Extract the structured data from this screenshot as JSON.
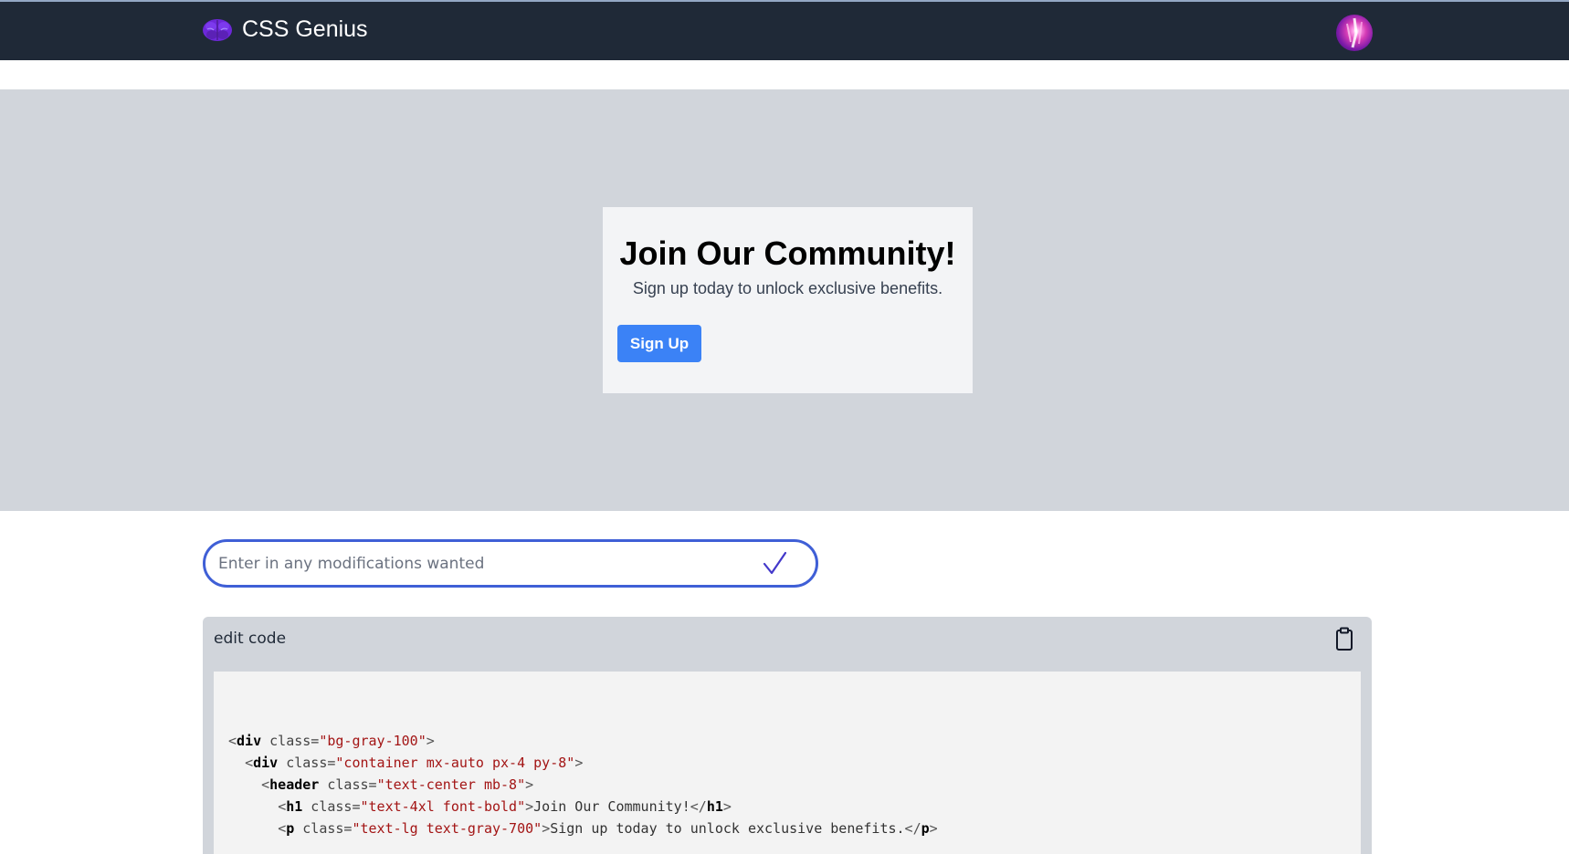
{
  "navbar": {
    "brand_name": "CSS Genius",
    "brand_icon": "brain-icon",
    "avatar_icon": "user-avatar"
  },
  "preview": {
    "title": "Join Our Community!",
    "subtitle": "Sign up today to unlock exclusive benefits.",
    "button_label": "Sign Up"
  },
  "modify": {
    "placeholder": "Enter in any modifications wanted",
    "value": "",
    "submit_icon": "check-icon"
  },
  "code_panel": {
    "header_label": "edit code",
    "copy_icon": "clipboard-icon",
    "lines": [
      {
        "indent": "",
        "tag": "div",
        "attr": "class",
        "val": "bg-gray-100",
        "text": "",
        "close": ""
      },
      {
        "indent": "  ",
        "tag": "div",
        "attr": "class",
        "val": "container mx-auto px-4 py-8",
        "text": "",
        "close": ""
      },
      {
        "indent": "    ",
        "tag": "header",
        "attr": "class",
        "val": "text-center mb-8",
        "text": "",
        "close": ""
      },
      {
        "indent": "      ",
        "tag": "h1",
        "attr": "class",
        "val": "text-4xl font-bold",
        "text": "Join Our Community!",
        "close": "h1"
      },
      {
        "indent": "      ",
        "tag": "p",
        "attr": "class",
        "val": "text-lg text-gray-700",
        "text": "Sign up today to unlock exclusive benefits.",
        "close": "p"
      }
    ]
  },
  "colors": {
    "navbar_bg": "#1f2937",
    "preview_bg": "#d1d5db",
    "card_bg": "#f3f4f6",
    "button_bg": "#3b82f6",
    "input_border": "#3f5fd6",
    "code_bg": "#f3f3f3",
    "brand_icon_color": "#6d28d9"
  }
}
